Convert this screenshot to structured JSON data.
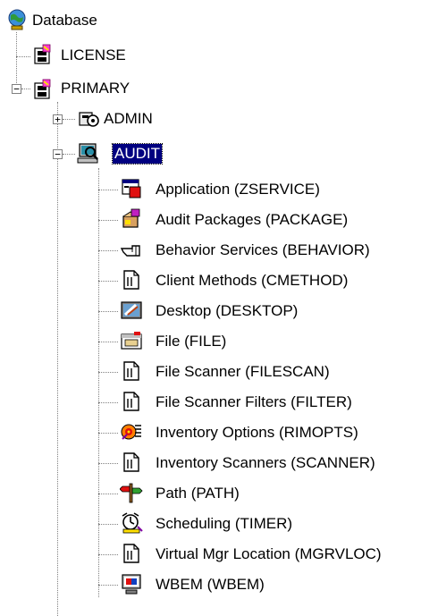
{
  "tree": {
    "root": {
      "label": "Database",
      "icon": "database-globe-icon"
    },
    "license": {
      "label": "LICENSE",
      "icon": "cabinet-icon"
    },
    "primary": {
      "label": "PRIMARY",
      "icon": "cabinet-icon",
      "toggle": "−"
    },
    "admin": {
      "label": "ADMIN",
      "icon": "admin-gear-icon",
      "toggle": "+"
    },
    "audit": {
      "label": "AUDIT",
      "icon": "audit-computer-icon",
      "toggle": "−",
      "selected": true
    },
    "children": [
      {
        "label": "Application (ZSERVICE)",
        "icon": "application-icon"
      },
      {
        "label": "Audit Packages (PACKAGE)",
        "icon": "package-icon"
      },
      {
        "label": "Behavior Services (BEHAVIOR)",
        "icon": "hand-pointer-icon"
      },
      {
        "label": "Client Methods (CMETHOD)",
        "icon": "document-icon"
      },
      {
        "label": "Desktop (DESKTOP)",
        "icon": "desktop-icon"
      },
      {
        "label": "File (FILE)",
        "icon": "file-folder-icon"
      },
      {
        "label": "File Scanner (FILESCAN)",
        "icon": "document-icon"
      },
      {
        "label": "File Scanner Filters (FILTER)",
        "icon": "document-icon"
      },
      {
        "label": "Inventory Options (RIMOPTS)",
        "icon": "inventory-options-icon"
      },
      {
        "label": "Inventory Scanners (SCANNER)",
        "icon": "document-icon"
      },
      {
        "label": "Path (PATH)",
        "icon": "path-signpost-icon"
      },
      {
        "label": "Scheduling (TIMER)",
        "icon": "scheduling-timer-icon"
      },
      {
        "label": "Virtual Mgr Location (MGRVLOC)",
        "icon": "document-icon"
      },
      {
        "label": "WBEM (WBEM)",
        "icon": "wbem-monitor-icon"
      }
    ]
  },
  "colors": {
    "selection": "#000080",
    "lines": "#808080"
  }
}
